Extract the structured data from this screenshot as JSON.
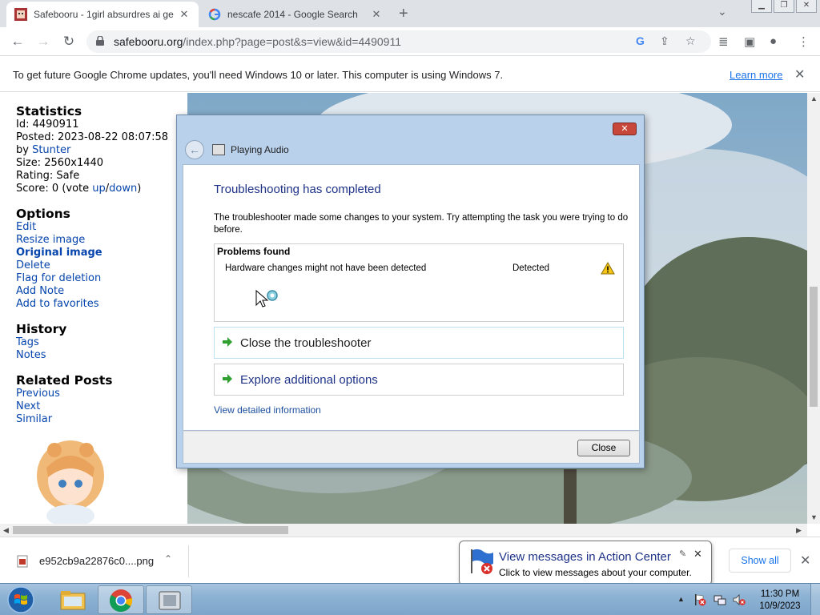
{
  "browser": {
    "tabs": [
      {
        "title": "Safebooru - 1girl absurdres ai ge",
        "active": true
      },
      {
        "title": "nescafe 2014 - Google Search",
        "active": false
      }
    ],
    "url_host": "safebooru.org",
    "url_path": "/index.php?page=post&s=view&id=4490911"
  },
  "infobar": {
    "message": "To get future Google Chrome updates, you'll need Windows 10 or later. This computer is using Windows 7.",
    "link": "Learn more"
  },
  "sidebar": {
    "statistics": {
      "heading": "Statistics",
      "id": "Id: 4490911",
      "posted": "Posted: 2023-08-22 08:07:58",
      "by_prefix": "by ",
      "by_user": "Stunter",
      "size": "Size: 2560x1440",
      "rating": "Rating: Safe",
      "score_prefix": "Score: 0 (vote ",
      "score_up": "up",
      "score_sep": "/",
      "score_down": "down",
      "score_suffix": ")"
    },
    "options": {
      "heading": "Options",
      "items": [
        "Edit",
        "Resize image",
        "Original image",
        "Delete",
        "Flag for deletion",
        "Add Note",
        "Add to favorites"
      ]
    },
    "history": {
      "heading": "History",
      "items": [
        "Tags",
        "Notes"
      ]
    },
    "related": {
      "heading": "Related Posts",
      "items": [
        "Previous",
        "Next",
        "Similar"
      ]
    }
  },
  "dialog": {
    "title": "Playing Audio",
    "close_glyph": "✕",
    "heading": "Troubleshooting has completed",
    "description": "The troubleshooter made some changes to your system. Try attempting the task you were trying to do before.",
    "problems_header": "Problems found",
    "problem": {
      "name": "Hardware changes might not have been detected",
      "status": "Detected"
    },
    "command_links": [
      "Close the troubleshooter",
      "Explore additional options"
    ],
    "details_link": "View detailed information",
    "close_button": "Close"
  },
  "downloads": {
    "file": "e952cb9a22876c0....png",
    "show_all": "Show all"
  },
  "notification": {
    "title": "View messages in Action Center",
    "text": "Click to view messages about your computer."
  },
  "taskbar": {
    "time": "11:30 PM",
    "date": "10/9/2023"
  },
  "colors": {
    "link": "#0645ad",
    "dialog_heading": "#1e3287",
    "chrome_accent": "#1a73e8"
  }
}
